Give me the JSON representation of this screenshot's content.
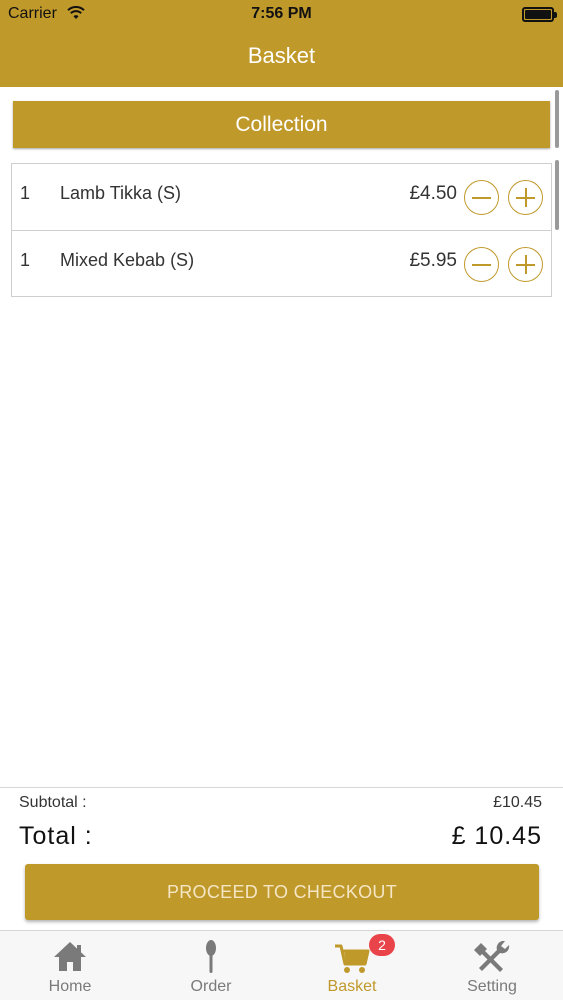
{
  "status_bar": {
    "carrier": "Carrier",
    "time": "7:56 PM"
  },
  "nav": {
    "title": "Basket"
  },
  "order_type": {
    "label": "Collection"
  },
  "items": [
    {
      "qty": "1",
      "name": "Lamb Tikka (S)",
      "price": "£4.50"
    },
    {
      "qty": "1",
      "name": "Mixed Kebab (S)",
      "price": "£5.95"
    }
  ],
  "summary": {
    "subtotal_label": "Subtotal :",
    "subtotal_value": "£10.45",
    "total_label": "Total :",
    "total_value": "£ 10.45"
  },
  "checkout": {
    "label": "PROCEED TO CHECKOUT"
  },
  "tab_bar": {
    "tabs": [
      {
        "label": "Home",
        "icon": "home-icon"
      },
      {
        "label": "Order",
        "icon": "spoon-icon"
      },
      {
        "label": "Basket",
        "icon": "cart-icon"
      },
      {
        "label": "Setting",
        "icon": "tools-icon"
      }
    ],
    "active_tab": "Basket",
    "basket_badge": "2"
  },
  "colors": {
    "accent": "#C0992B",
    "badge": "#E8444A",
    "inactive_tab": "#7A7A7A"
  }
}
